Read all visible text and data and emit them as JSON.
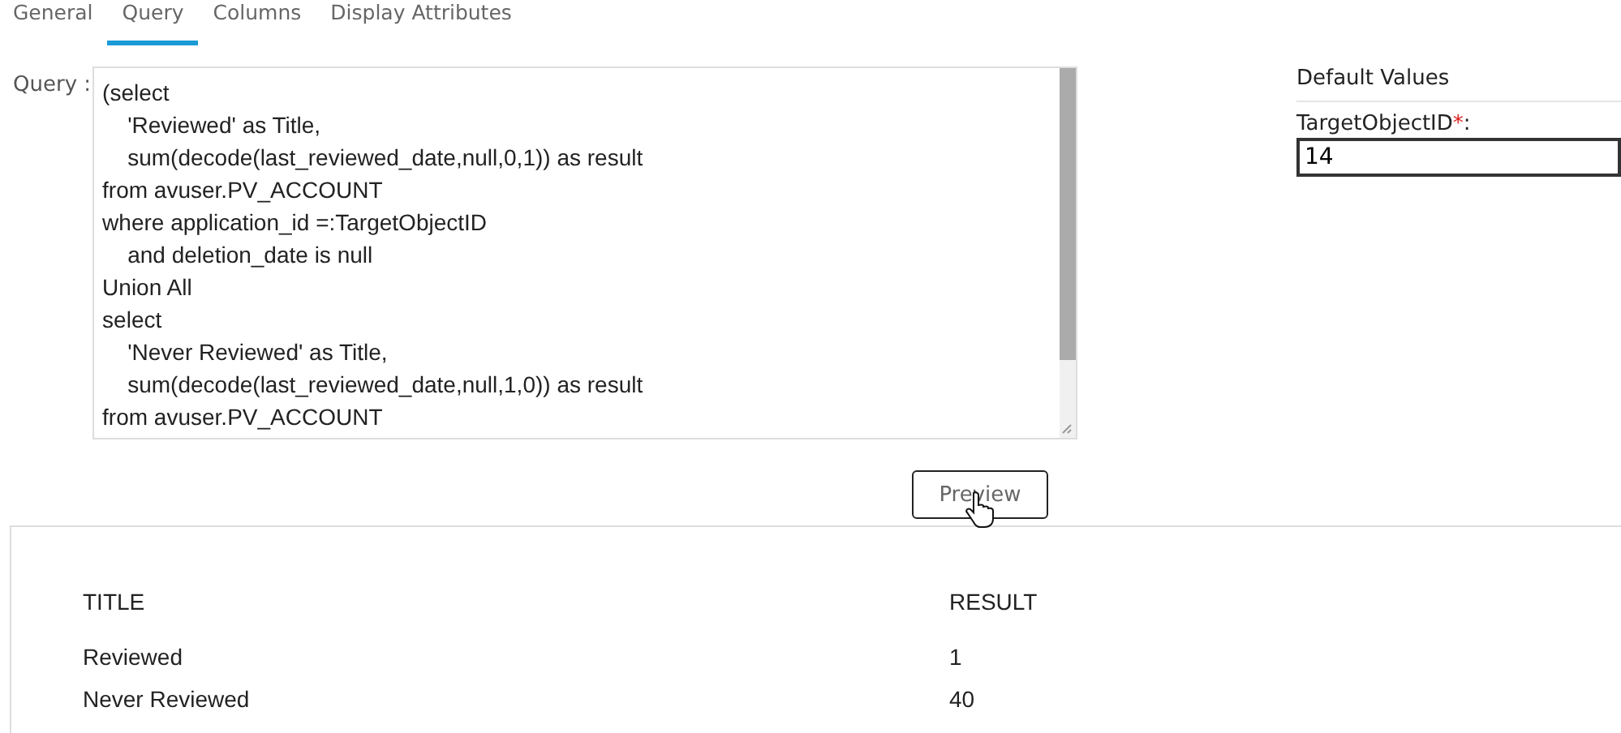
{
  "tabs": [
    {
      "label": "General",
      "selected": false
    },
    {
      "label": "Query",
      "selected": true
    },
    {
      "label": "Columns",
      "selected": false
    },
    {
      "label": "Display Attributes",
      "selected": false
    }
  ],
  "query": {
    "label": "Query :",
    "lines": [
      "(select",
      "    'Reviewed' as Title,",
      "    sum(decode(last_reviewed_date,null,0,1)) as result",
      "from avuser.PV_ACCOUNT",
      "where application_id =:TargetObjectID",
      "    and deletion_date is null",
      "Union All",
      "select",
      "    'Never Reviewed' as Title,",
      "    sum(decode(last_reviewed_date,null,1,0)) as result",
      "from avuser.PV_ACCOUNT"
    ]
  },
  "default_values": {
    "title": "Default Values",
    "field_label": "TargetObjectID",
    "required_mark": "*",
    "label_suffix": ":",
    "value": "14"
  },
  "preview_button": "Preview",
  "results": {
    "columns": [
      "TITLE",
      "RESULT"
    ],
    "rows": [
      [
        "Reviewed",
        "1"
      ],
      [
        "Never Reviewed",
        "40"
      ]
    ]
  }
}
